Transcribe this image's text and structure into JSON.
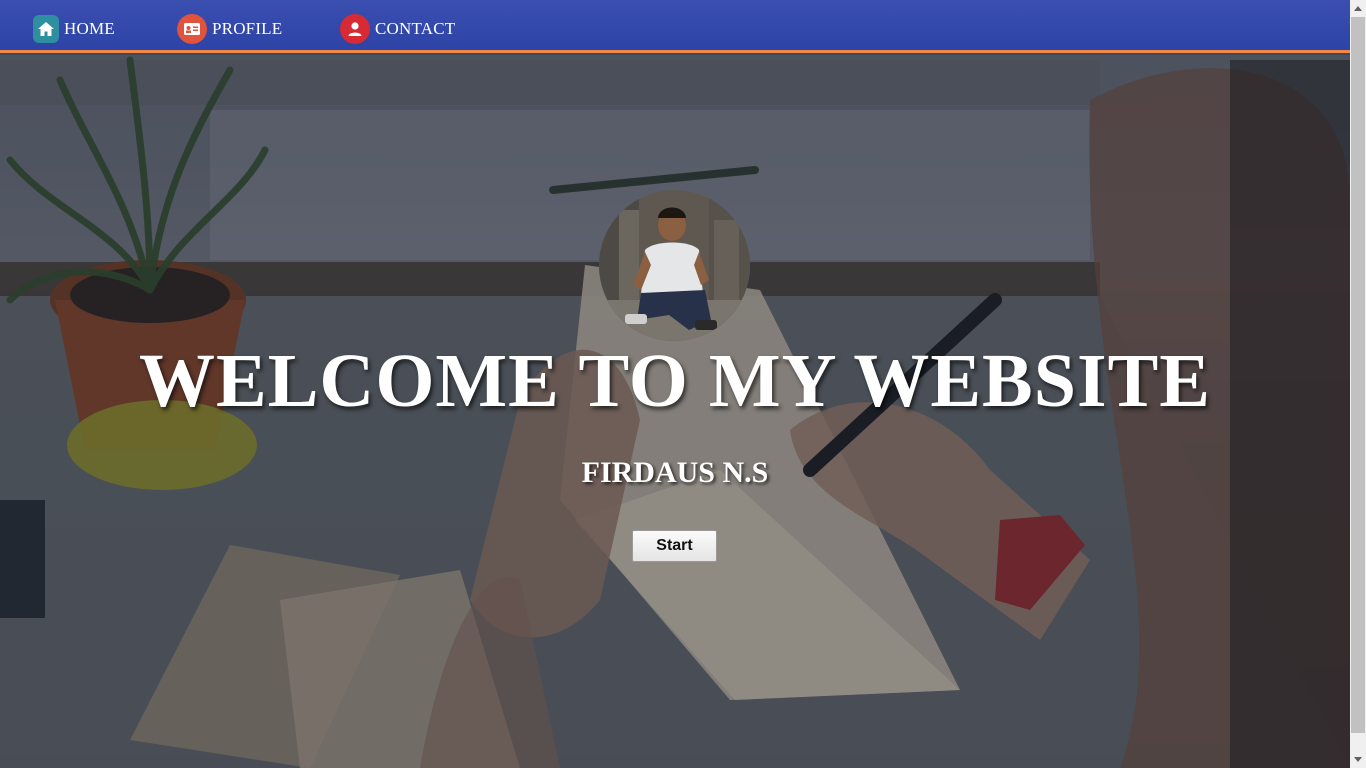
{
  "nav": {
    "items": [
      {
        "label": "HOME",
        "icon": "home-icon",
        "color": "#2e8fa0"
      },
      {
        "label": "PROFILE",
        "icon": "id-card-icon",
        "color": "#e0533d"
      },
      {
        "label": "CONTACT",
        "icon": "user-icon",
        "color": "#d62a34"
      }
    ],
    "background": "#2d43a6",
    "accent_border": "#f0884a"
  },
  "hero": {
    "title": "WELCOME TO MY WEBSITE",
    "name": "FIRDAUS N.S",
    "start_label": "Start"
  }
}
